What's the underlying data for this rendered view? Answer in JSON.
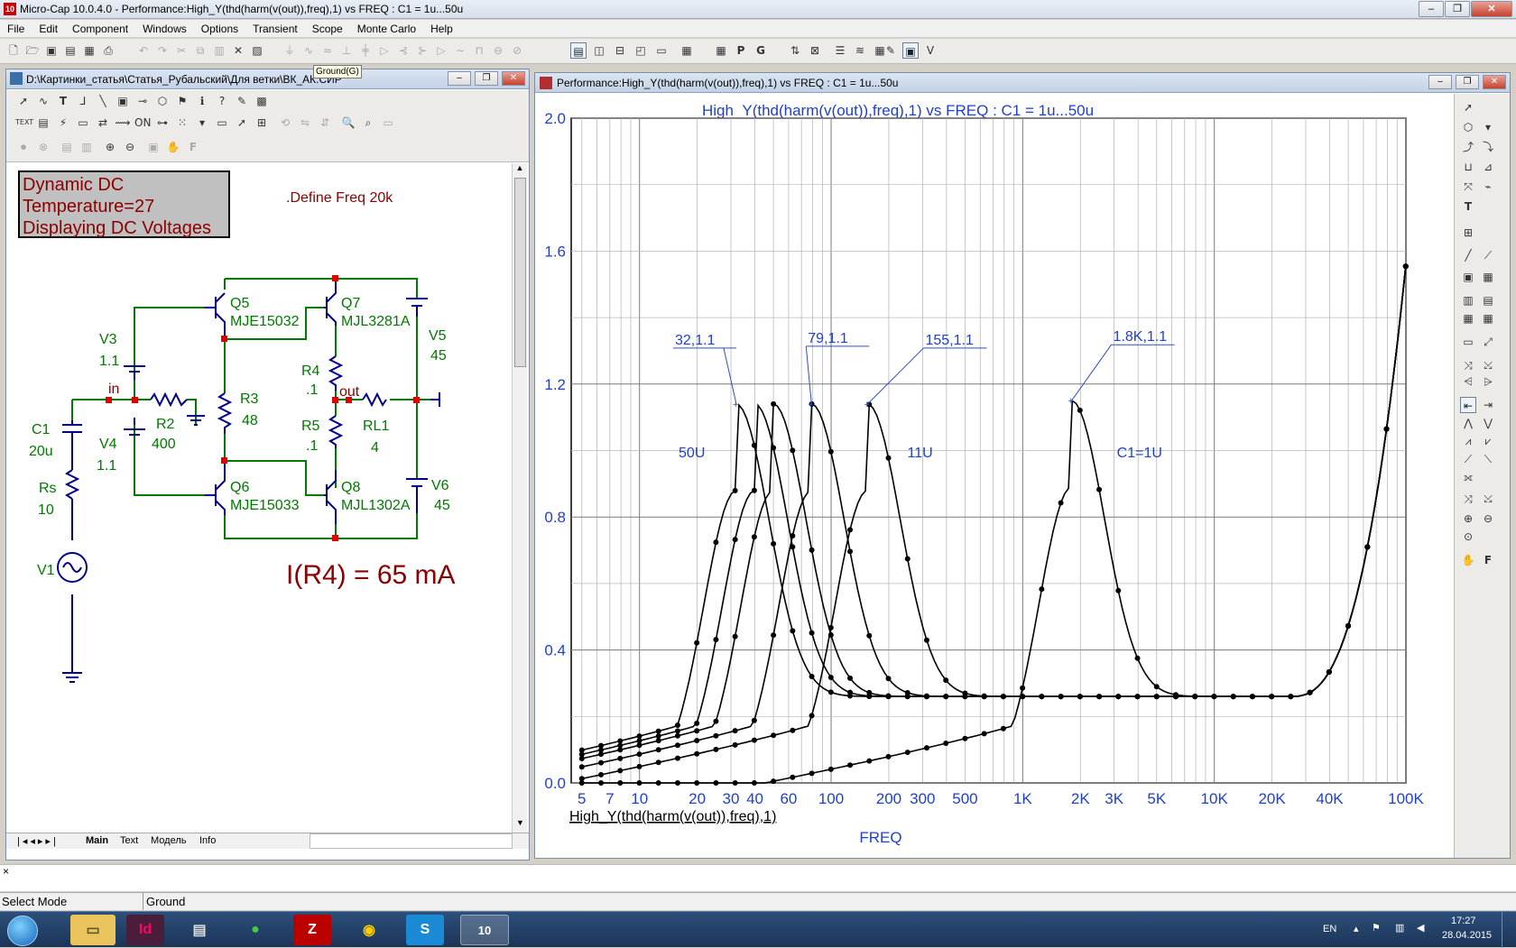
{
  "app": {
    "title": "Micro-Cap 10.0.4.0 - Performance:High_Y(thd(harm(v(out)),freq),1) vs FREQ : C1 = 1u...50u",
    "icon_text": "10"
  },
  "menu": [
    "File",
    "Edit",
    "Component",
    "Windows",
    "Options",
    "Transient",
    "Scope",
    "Monte Carlo",
    "Help"
  ],
  "tooltip": "Ground(G)",
  "schematic": {
    "title": "D:\\Картинки_статья\\Статья_Рубальский\\Для ветки\\ВК_АК.СИР",
    "status_box": [
      "Dynamic DC",
      "Temperature=27",
      "Displaying DC Voltages"
    ],
    "define_text": ".Define Freq 20k",
    "current_text": "I(R4) = 65 mA",
    "components": {
      "q5": "Q5",
      "q5m": "MJE15032",
      "q7": "Q7",
      "q7m": "MJL3281A",
      "q6": "Q6",
      "q6m": "MJE15033",
      "q8": "Q8",
      "q8m": "MJL1302A",
      "v3": "V3",
      "v3v": "1.1",
      "v4": "V4",
      "v4v": "1.1",
      "v5": "V5",
      "v5v": "45",
      "v6": "V6",
      "v6v": "45",
      "r2": "R2",
      "r2v": "400",
      "r3": "R3",
      "r3v": "48",
      "r4": "R4",
      "r4v": ".1",
      "r5": "R5",
      "r5v": ".1",
      "rl1": "RL1",
      "rl1v": "4",
      "c1": "C1",
      "c1v": "20u",
      "rs": "Rs",
      "rsv": "10",
      "v1": "V1",
      "in": "in",
      "out": "out"
    },
    "tabs": [
      "Main",
      "Text",
      "Модель",
      "Info"
    ]
  },
  "plot_window": {
    "title": "Performance:High_Y(thd(harm(v(out)),freq),1) vs FREQ : C1 = 1u...50u"
  },
  "chart_data": {
    "type": "line",
    "title": "High_Y(thd(harm(v(out)),freq),1) vs FREQ : C1 = 1u...50u",
    "xlabel": "FREQ",
    "ylabel": "High_Y(thd(harm(v(out)),freq),1)",
    "x_scale": "log",
    "xlim": [
      4.4,
      100000
    ],
    "ylim": [
      0,
      2.0
    ],
    "x_ticks": [
      5,
      7,
      10,
      20,
      30,
      40,
      60,
      100,
      200,
      300,
      500,
      1000,
      2000,
      3000,
      5000,
      10000,
      20000,
      40000,
      100000
    ],
    "x_tick_labels": [
      "5",
      "7",
      "10",
      "20",
      "30",
      "40",
      "60",
      "100",
      "200",
      "300",
      "500",
      "1K",
      "2K",
      "3K",
      "5K",
      "10K",
      "20K",
      "40K",
      "100K"
    ],
    "y_ticks": [
      0,
      0.4,
      0.8,
      1.2,
      1.6,
      2.0
    ],
    "y_tick_labels": [
      "0.0",
      "0.4",
      "0.8",
      "1.2",
      "1.6",
      "2.0"
    ],
    "grid": true,
    "series_peaks": [
      {
        "name": "50U",
        "peak_freq": 32,
        "peak": 1.14
      },
      {
        "name": "",
        "peak_freq": 40,
        "peak": 1.14
      },
      {
        "name": "",
        "peak_freq": 50,
        "peak": 1.14
      },
      {
        "name": "",
        "peak_freq": 79,
        "peak": 1.14
      },
      {
        "name": "11U",
        "peak_freq": 155,
        "peak": 1.14
      },
      {
        "name": "C1=1U",
        "peak_freq": 1800,
        "peak": 1.15
      }
    ],
    "annotations": [
      {
        "text": "32,1.1",
        "x": 32,
        "y": 1.14
      },
      {
        "text": "79,1.1",
        "x": 79,
        "y": 1.14
      },
      {
        "text": "155,1.1",
        "x": 155,
        "y": 1.14
      },
      {
        "text": "1.8K,1.1",
        "x": 1800,
        "y": 1.15
      }
    ],
    "series_labels": [
      {
        "text": "50U",
        "x": 16,
        "y": 0.98
      },
      {
        "text": "11U",
        "x": 250,
        "y": 0.98
      },
      {
        "text": "C1=1U",
        "x": 3100,
        "y": 0.98
      }
    ]
  },
  "status": {
    "mode": "Select Mode",
    "hint": "Ground"
  },
  "taskbar": {
    "lang": "EN",
    "time": "17:27",
    "date": "28.04.2015"
  }
}
